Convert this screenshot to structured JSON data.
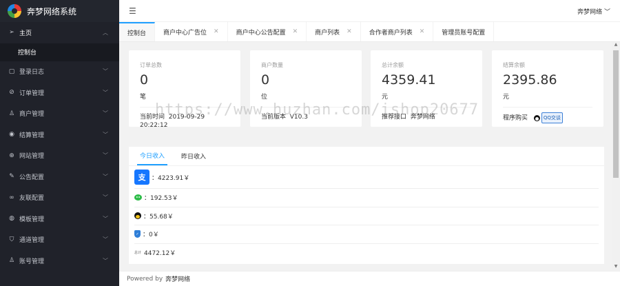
{
  "app": {
    "title": "奔梦网络系统"
  },
  "sidebar": {
    "home": {
      "label": "主页",
      "icon": "paper-plane-icon"
    },
    "sub_active": "控制台",
    "items": [
      {
        "label": "登录日志",
        "icon": "file-icon"
      },
      {
        "label": "订单管理",
        "icon": "check-circle-icon"
      },
      {
        "label": "商户管理",
        "icon": "user-icon"
      },
      {
        "label": "结算管理",
        "icon": "target-icon"
      },
      {
        "label": "网站管理",
        "icon": "plus-circle-icon"
      },
      {
        "label": "公告配置",
        "icon": "pencil-icon"
      },
      {
        "label": "友联配置",
        "icon": "link-icon"
      },
      {
        "label": "模板管理",
        "icon": "palette-icon"
      },
      {
        "label": "通道管理",
        "icon": "shield-icon"
      },
      {
        "label": "账号管理",
        "icon": "user-icon"
      }
    ]
  },
  "topbar": {
    "user": "奔梦网络"
  },
  "tabs": [
    {
      "label": "控制台",
      "active": true
    },
    {
      "label": "商户中心广告位"
    },
    {
      "label": "商户中心公告配置"
    },
    {
      "label": "商户列表"
    },
    {
      "label": "合作者商户列表"
    },
    {
      "label": "管理员账号配置"
    }
  ],
  "cards": [
    {
      "title": "订单总数",
      "value": "0",
      "unit": "笔",
      "foot_label": "当前时间",
      "foot_value": "2019-09-29",
      "foot_value2": "20:22:12"
    },
    {
      "title": "商户数量",
      "value": "0",
      "unit": "位",
      "foot_label": "当前版本",
      "foot_value": "V10.3"
    },
    {
      "title": "总计余额",
      "value": "4359.41",
      "unit": "元",
      "foot_label": "推荐接口",
      "foot_value": "奔梦网络"
    },
    {
      "title": "结算余额",
      "value": "2395.86",
      "unit": "元",
      "foot_label": "程序购买",
      "foot_value": "QQ交谈"
    }
  ],
  "income": {
    "tabs": [
      "今日收入",
      "昨日收入"
    ],
    "rows": [
      {
        "icon": "alipay-icon",
        "glyph": "支",
        "amount": "：4223.91￥"
      },
      {
        "icon": "wechat-icon",
        "amount": "：192.53￥"
      },
      {
        "icon": "qq-icon",
        "amount": "：55.68￥"
      },
      {
        "icon": "shield-pay-icon",
        "amount": "：0￥"
      },
      {
        "icon": "total-icon",
        "glyph": "总计",
        "amount": "4472.12￥"
      }
    ]
  },
  "footer": {
    "powered": "Powered by",
    "brand": "奔梦网络"
  },
  "watermark": "https://www.huzhan.com/ishop20677"
}
